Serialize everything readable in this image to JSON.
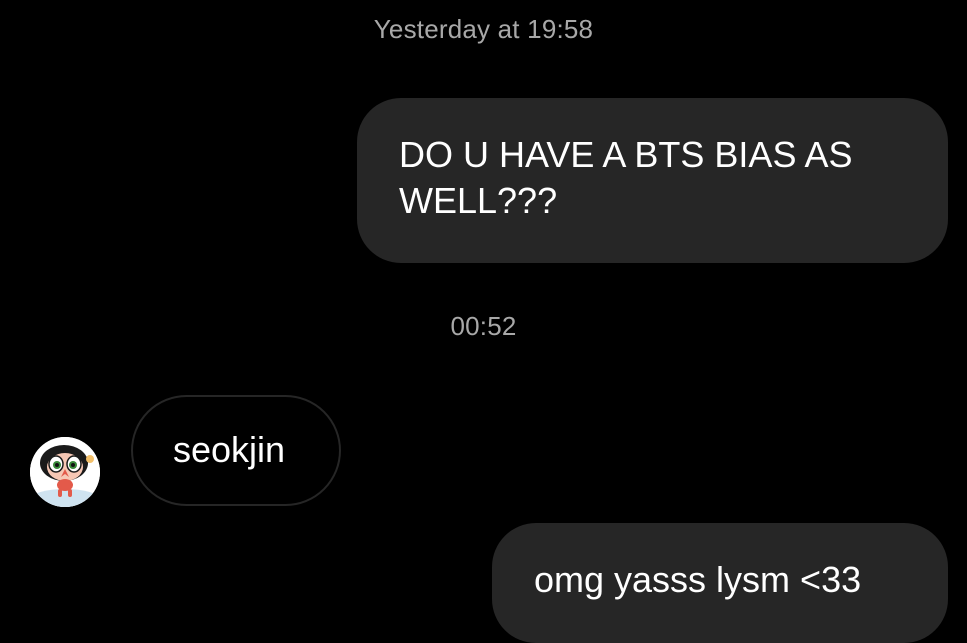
{
  "thread": {
    "timestamp_1": "Yesterday at 19:58",
    "timestamp_2": "00:52"
  },
  "messages": [
    {
      "direction": "outgoing",
      "text": "DO U HAVE A BTS BIAS AS WELL???"
    },
    {
      "direction": "incoming",
      "text": "seokjin"
    },
    {
      "direction": "outgoing",
      "text": "omg yasss lysm <33"
    }
  ],
  "sender_avatar": {
    "icon": "cartoon-character-avatar-icon"
  },
  "colors": {
    "background": "#000000",
    "outgoing_bubble": "#262626",
    "incoming_bubble_border": "#262626",
    "timestamp_text": "#a8a8a8",
    "message_text": "#ffffff"
  }
}
